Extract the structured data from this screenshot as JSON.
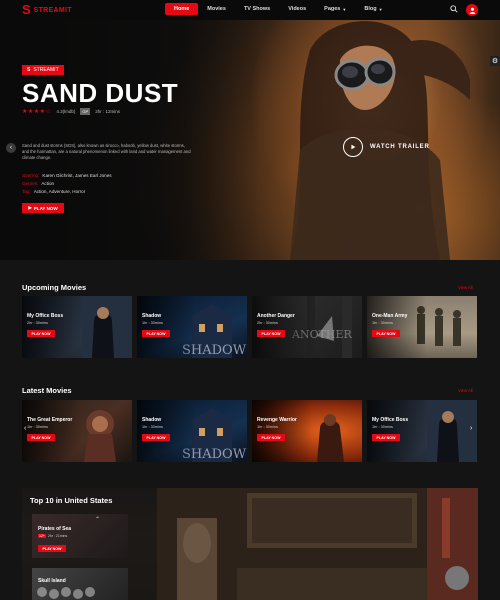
{
  "nav": {
    "logo_mark": "S",
    "logo_text": "STREAMIT",
    "items": [
      {
        "label": "Home",
        "active": true,
        "caret": false
      },
      {
        "label": "Movies",
        "active": false,
        "caret": false
      },
      {
        "label": "TV Shows",
        "active": false,
        "caret": false
      },
      {
        "label": "Videos",
        "active": false,
        "caret": false
      },
      {
        "label": "Pages",
        "active": false,
        "caret": true
      },
      {
        "label": "Blog",
        "active": false,
        "caret": true
      }
    ],
    "search_icon": "search-icon",
    "user_icon": "user-icon"
  },
  "hero": {
    "tag": "STREAMIT",
    "title": "SAND DUST",
    "rating_stars": "★★★★☆",
    "rating_value": "4.3(lmdb)",
    "pg": "GP",
    "duration": "2hr : 12mins",
    "description": "Sand and dust storms (SDS), also known as sirocco, haboob, yellow dust, white storms, and the harmattan, are a natural phenomenon linked with land and water management and climate change.",
    "credits": [
      {
        "label": "Starring:",
        "value": "Karen Gilchrist, James Earl Jones"
      },
      {
        "label": "Genres:",
        "value": "Action"
      },
      {
        "label": "Tag:",
        "value": "Action, Adventure, Horror"
      }
    ],
    "play_label": "PLAY NOW",
    "trailer_label": "WATCH TRAILER"
  },
  "upcoming": {
    "title": "Upcoming Movies",
    "view_all": "View All",
    "cards": [
      {
        "title": "My Office Boss",
        "meta": "2hr : 30mins",
        "play": "PLAY NOW"
      },
      {
        "title": "Shadow",
        "meta": "1hr : 30mins",
        "play": "PLAY NOW"
      },
      {
        "title": "Another Danger",
        "meta": "2hr : 30mins",
        "play": "PLAY NOW"
      },
      {
        "title": "One-Man Army",
        "meta": "1hr : 30mins",
        "play": "PLAY NOW"
      }
    ]
  },
  "latest": {
    "title": "Latest Movies",
    "view_all": "View All",
    "cards": [
      {
        "title": "The Great Emperor",
        "meta": "1hr : 30mins",
        "play": "PLAY NOW"
      },
      {
        "title": "Shadow",
        "meta": "1hr : 30mins",
        "play": "PLAY NOW"
      },
      {
        "title": "Revenge Warrior",
        "meta": "1hr : 30mins",
        "play": "PLAY NOW"
      },
      {
        "title": "My Office Boss",
        "meta": "1hr : 30mins",
        "play": "PLAY NOW"
      }
    ]
  },
  "top10": {
    "title": "Top 10 in United States",
    "card1": {
      "title": "Pirates of Sea",
      "rating": "12+",
      "meta": "2hr : 21mins",
      "play": "PLAY NOW"
    },
    "card2": {
      "title": "Skull Island"
    }
  },
  "colors": {
    "accent": "#e50914",
    "bg": "#141414"
  }
}
